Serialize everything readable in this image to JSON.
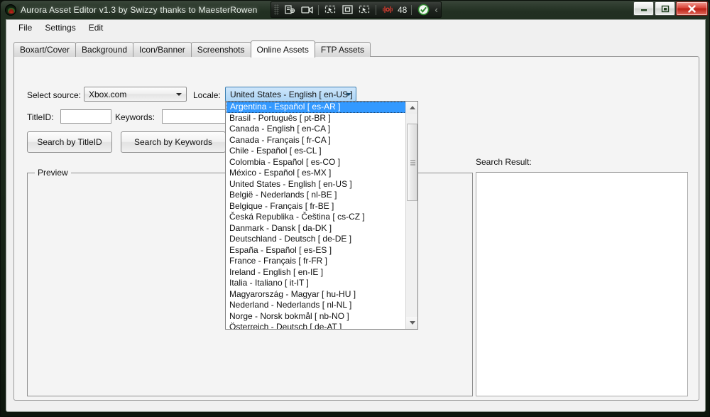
{
  "window": {
    "title": "Aurora Asset Editor v1.3 by Swizzy thanks to MaesterRowen",
    "app_icon": "aurora-logo-icon",
    "controls": {
      "minimize": "–",
      "maximize": "❐",
      "close": "✕"
    }
  },
  "capture_toolbar": {
    "icons": [
      "capture-region-icon",
      "record-video-icon",
      "cursor-capture-icon",
      "fullscreen-capture-icon",
      "select-window-icon"
    ],
    "rec_indicator": "rec-icon",
    "counter": "48",
    "status": "check-circle-icon",
    "collapse": "‹"
  },
  "menu": {
    "items": [
      {
        "label": "File"
      },
      {
        "label": "Settings"
      },
      {
        "label": "Edit"
      }
    ]
  },
  "tabs": [
    {
      "label": "Boxart/Cover",
      "active": false
    },
    {
      "label": "Background",
      "active": false
    },
    {
      "label": "Icon/Banner",
      "active": false
    },
    {
      "label": "Screenshots",
      "active": false
    },
    {
      "label": "Online Assets",
      "active": true
    },
    {
      "label": "FTP Assets",
      "active": false
    }
  ],
  "online_assets": {
    "select_source_label": "Select source:",
    "source_value": "Xbox.com",
    "locale_label": "Locale:",
    "locale_value": "United States - English [ en-US ]",
    "titleid_label": "TitleID:",
    "titleid_value": "",
    "keywords_label": "Keywords:",
    "keywords_value": "",
    "search_titleid_button": "Search by TitleID",
    "search_keywords_button": "Search by Keywords",
    "preview_group_title": "Preview",
    "search_result_label": "Search Result:",
    "search_result_items": []
  },
  "locale_dropdown": {
    "selected_index": 0,
    "scroll_thumb_top_pct": 5,
    "scroll_thumb_height_pct": 38,
    "items": [
      "Argentina - Español [ es-AR ]",
      "Brasil - Português [ pt-BR ]",
      "Canada - English [ en-CA ]",
      "Canada - Français [ fr-CA ]",
      "Chile - Español [ es-CL ]",
      "Colombia - Español [ es-CO ]",
      "México - Español [ es-MX ]",
      "United States - English [ en-US ]",
      "België - Nederlands [ nl-BE ]",
      "Belgique - Français [ fr-BE ]",
      "Česká Republika - Čeština [ cs-CZ ]",
      "Danmark - Dansk [ da-DK ]",
      "Deutschland - Deutsch [ de-DE ]",
      "España - Español [ es-ES ]",
      "France - Français [ fr-FR ]",
      "Ireland - English [ en-IE ]",
      "Italia - Italiano [ it-IT ]",
      "Magyarország - Magyar [ hu-HU ]",
      "Nederland - Nederlands [ nl-NL ]",
      "Norge - Norsk bokmål [ nb-NO ]",
      "Österreich - Deutsch [ de-AT ]"
    ]
  },
  "colors": {
    "selection_blue": "#3399ff",
    "combo_focus_blue": "#bcddf8",
    "frame_dark_green": "#1a271a",
    "client_bg": "#f0f0f0",
    "close_red": "#d9453a"
  }
}
